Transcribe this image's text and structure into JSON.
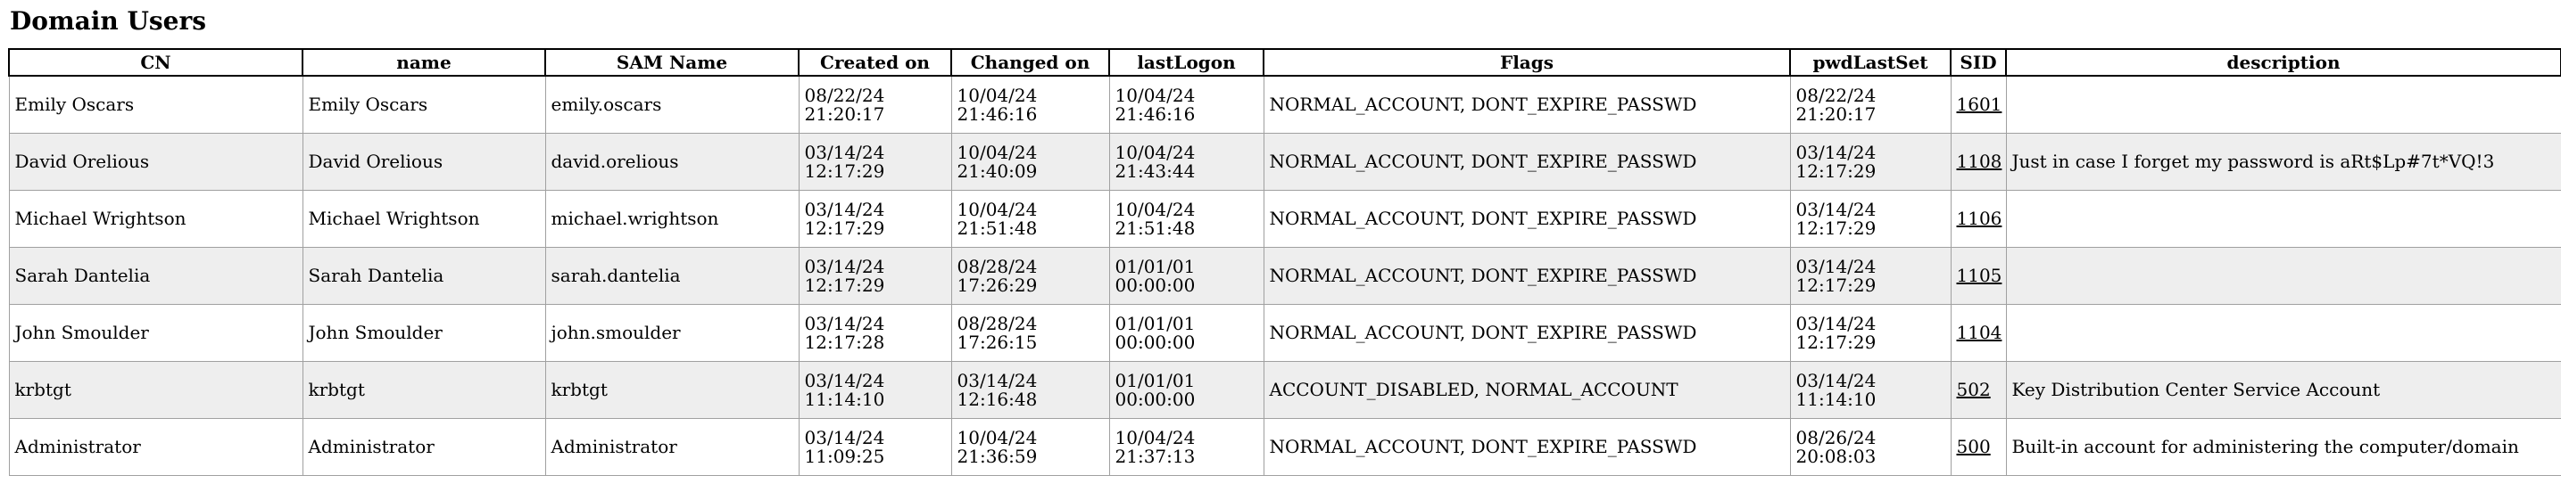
{
  "page_title": "Domain Users",
  "columns": [
    "CN",
    "name",
    "SAM Name",
    "Created on",
    "Changed on",
    "lastLogon",
    "Flags",
    "pwdLastSet",
    "SID",
    "description"
  ],
  "rows": [
    {
      "cn": "Emily Oscars",
      "name": "Emily Oscars",
      "sam": "emily.oscars",
      "created_date": "08/22/24",
      "created_time": "21:20:17",
      "changed_date": "10/04/24",
      "changed_time": "21:46:16",
      "logon_date": "10/04/24",
      "logon_time": "21:46:16",
      "flags": "NORMAL_ACCOUNT, DONT_EXPIRE_PASSWD",
      "pwd_date": "08/22/24",
      "pwd_time": "21:20:17",
      "sid": "1601",
      "description": ""
    },
    {
      "cn": "David Orelious",
      "name": "David Orelious",
      "sam": "david.orelious",
      "created_date": "03/14/24",
      "created_time": "12:17:29",
      "changed_date": "10/04/24",
      "changed_time": "21:40:09",
      "logon_date": "10/04/24",
      "logon_time": "21:43:44",
      "flags": "NORMAL_ACCOUNT, DONT_EXPIRE_PASSWD",
      "pwd_date": "03/14/24",
      "pwd_time": "12:17:29",
      "sid": "1108",
      "description": "Just in case I forget my password is aRt$Lp#7t*VQ!3"
    },
    {
      "cn": "Michael Wrightson",
      "name": "Michael Wrightson",
      "sam": "michael.wrightson",
      "created_date": "03/14/24",
      "created_time": "12:17:29",
      "changed_date": "10/04/24",
      "changed_time": "21:51:48",
      "logon_date": "10/04/24",
      "logon_time": "21:51:48",
      "flags": "NORMAL_ACCOUNT, DONT_EXPIRE_PASSWD",
      "pwd_date": "03/14/24",
      "pwd_time": "12:17:29",
      "sid": "1106",
      "description": ""
    },
    {
      "cn": "Sarah Dantelia",
      "name": "Sarah Dantelia",
      "sam": "sarah.dantelia",
      "created_date": "03/14/24",
      "created_time": "12:17:29",
      "changed_date": "08/28/24",
      "changed_time": "17:26:29",
      "logon_date": "01/01/01",
      "logon_time": "00:00:00",
      "flags": "NORMAL_ACCOUNT, DONT_EXPIRE_PASSWD",
      "pwd_date": "03/14/24",
      "pwd_time": "12:17:29",
      "sid": "1105",
      "description": ""
    },
    {
      "cn": "John Smoulder",
      "name": "John Smoulder",
      "sam": "john.smoulder",
      "created_date": "03/14/24",
      "created_time": "12:17:28",
      "changed_date": "08/28/24",
      "changed_time": "17:26:15",
      "logon_date": "01/01/01",
      "logon_time": "00:00:00",
      "flags": "NORMAL_ACCOUNT, DONT_EXPIRE_PASSWD",
      "pwd_date": "03/14/24",
      "pwd_time": "12:17:29",
      "sid": "1104",
      "description": ""
    },
    {
      "cn": "krbtgt",
      "name": "krbtgt",
      "sam": "krbtgt",
      "created_date": "03/14/24",
      "created_time": "11:14:10",
      "changed_date": "03/14/24",
      "changed_time": "12:16:48",
      "logon_date": "01/01/01",
      "logon_time": "00:00:00",
      "flags": "ACCOUNT_DISABLED, NORMAL_ACCOUNT",
      "pwd_date": "03/14/24",
      "pwd_time": "11:14:10",
      "sid": "502",
      "description": "Key Distribution Center Service Account"
    },
    {
      "cn": "Administrator",
      "name": "Administrator",
      "sam": "Administrator",
      "created_date": "03/14/24",
      "created_time": "11:09:25",
      "changed_date": "10/04/24",
      "changed_time": "21:36:59",
      "logon_date": "10/04/24",
      "logon_time": "21:37:13",
      "flags": "NORMAL_ACCOUNT, DONT_EXPIRE_PASSWD",
      "pwd_date": "08/26/24",
      "pwd_time": "20:08:03",
      "sid": "500",
      "description": "Built-in account for administering the computer/domain"
    }
  ]
}
